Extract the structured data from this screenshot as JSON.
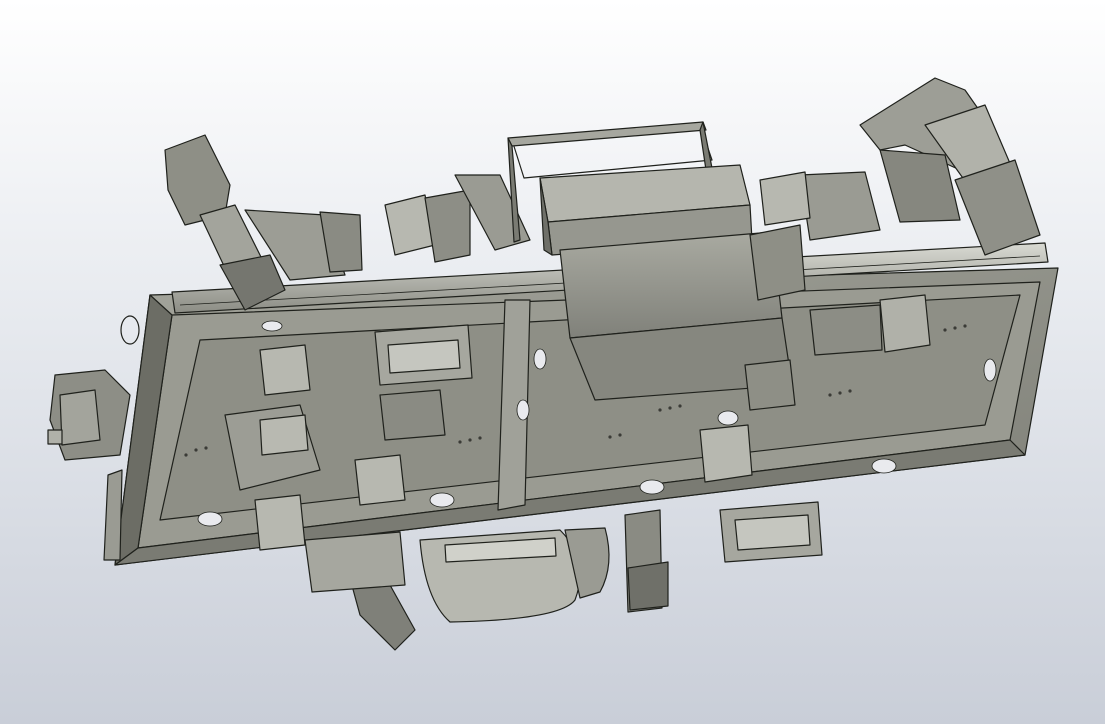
{
  "viewport": {
    "background_top": "#ffffff",
    "background_bottom": "#c9ced8",
    "model_color": "#8e8f86",
    "model_color_light": "#b4b5ac",
    "model_color_dark": "#6c6d65"
  }
}
